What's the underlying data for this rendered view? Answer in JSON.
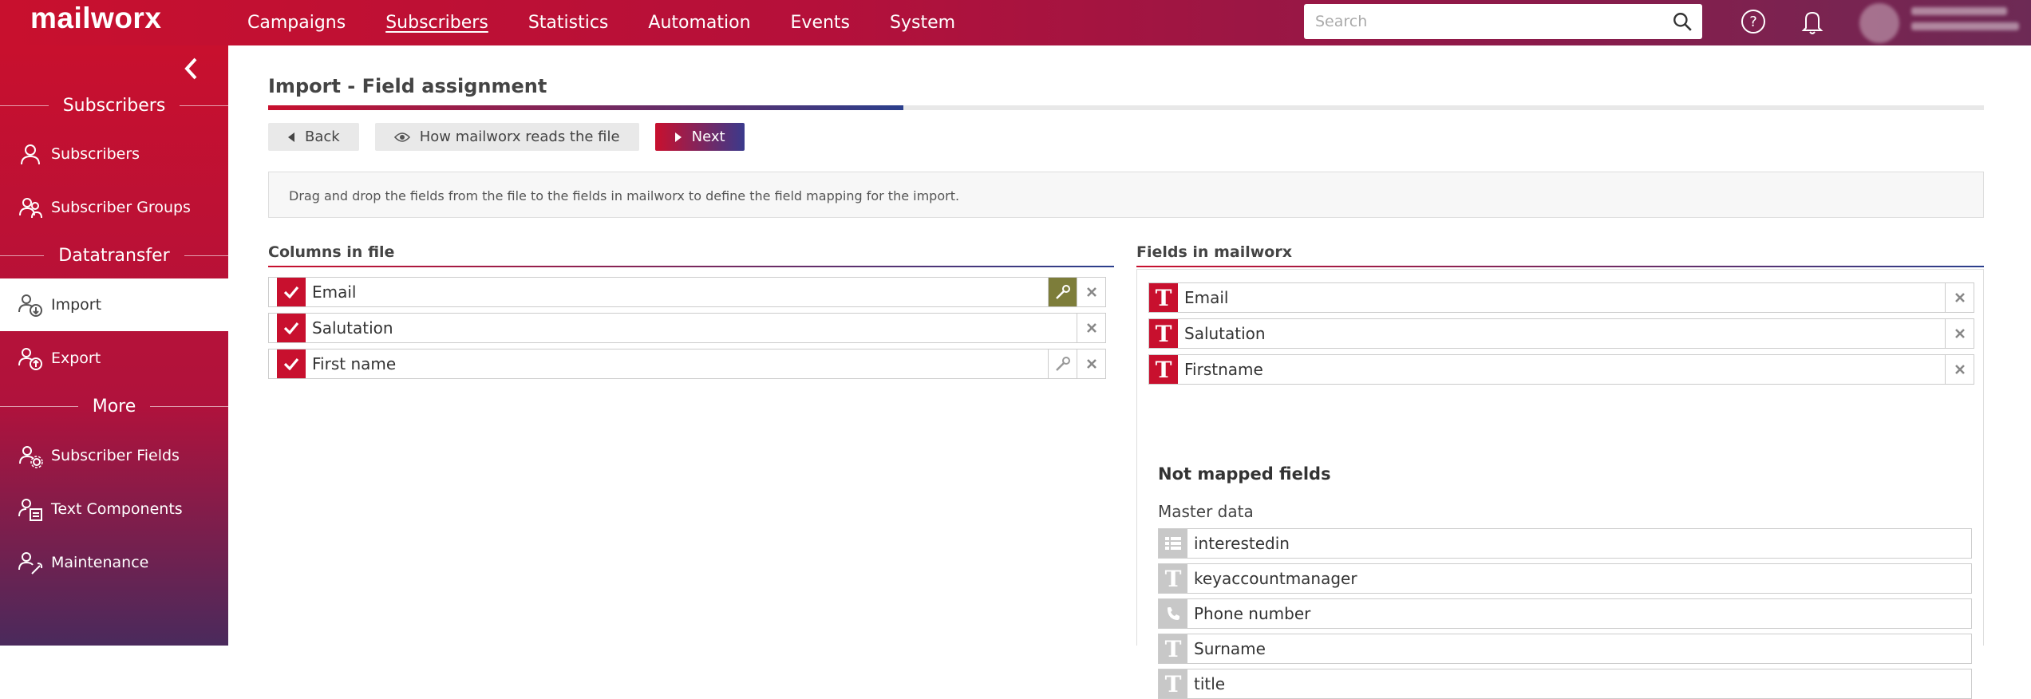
{
  "app": {
    "logo": "mailworx"
  },
  "topnav": [
    {
      "label": "Campaigns",
      "active": false
    },
    {
      "label": "Subscribers",
      "active": true
    },
    {
      "label": "Statistics",
      "active": false
    },
    {
      "label": "Automation",
      "active": false
    },
    {
      "label": "Events",
      "active": false
    },
    {
      "label": "System",
      "active": false
    }
  ],
  "search": {
    "placeholder": "Search",
    "value": ""
  },
  "sidebar": {
    "sections": [
      {
        "title": "Subscribers",
        "items": [
          {
            "label": "Subscribers",
            "icon": "user-icon"
          },
          {
            "label": "Subscriber Groups",
            "icon": "users-group-icon"
          }
        ]
      },
      {
        "title": "Datatransfer",
        "items": [
          {
            "label": "Import",
            "icon": "import-icon",
            "active": true
          },
          {
            "label": "Export",
            "icon": "export-icon"
          }
        ]
      },
      {
        "title": "More",
        "items": [
          {
            "label": "Subscriber Fields",
            "icon": "users-settings-icon"
          },
          {
            "label": "Text Components",
            "icon": "text-components-icon"
          },
          {
            "label": "Maintenance",
            "icon": "maintenance-icon"
          }
        ]
      }
    ]
  },
  "page": {
    "title": "Import - Field assignment",
    "progress": 0.37,
    "buttons": {
      "back": "Back",
      "how": "How mailworx reads the file",
      "next": "Next"
    },
    "info": "Drag and drop the fields from the file to the fields in mailworx to define the field mapping for the import."
  },
  "columns_in_file": {
    "title": "Columns in file",
    "rows": [
      {
        "label": "Email",
        "key": "active"
      },
      {
        "label": "Salutation",
        "key": "none"
      },
      {
        "label": "First name",
        "key": "inactive"
      }
    ]
  },
  "fields_in_mailworx": {
    "title": "Fields in mailworx",
    "mapped": [
      {
        "label": "Email",
        "icon": "text-type-icon"
      },
      {
        "label": "Salutation",
        "icon": "text-type-icon"
      },
      {
        "label": "Firstname",
        "icon": "text-type-icon"
      }
    ],
    "not_mapped_title": "Not mapped fields",
    "master_data_label": "Master data",
    "not_mapped": [
      {
        "label": "interestedin",
        "icon": "list-type-icon"
      },
      {
        "label": "keyaccountmanager",
        "icon": "text-type-icon"
      },
      {
        "label": "Phone number",
        "icon": "phone-type-icon"
      },
      {
        "label": "Surname",
        "icon": "text-type-icon"
      },
      {
        "label": "title",
        "icon": "text-type-icon"
      }
    ]
  },
  "colors": {
    "brand_red": "#c8102e",
    "brand_blue": "#2b3f8c",
    "key_active": "#7d7d3a"
  }
}
